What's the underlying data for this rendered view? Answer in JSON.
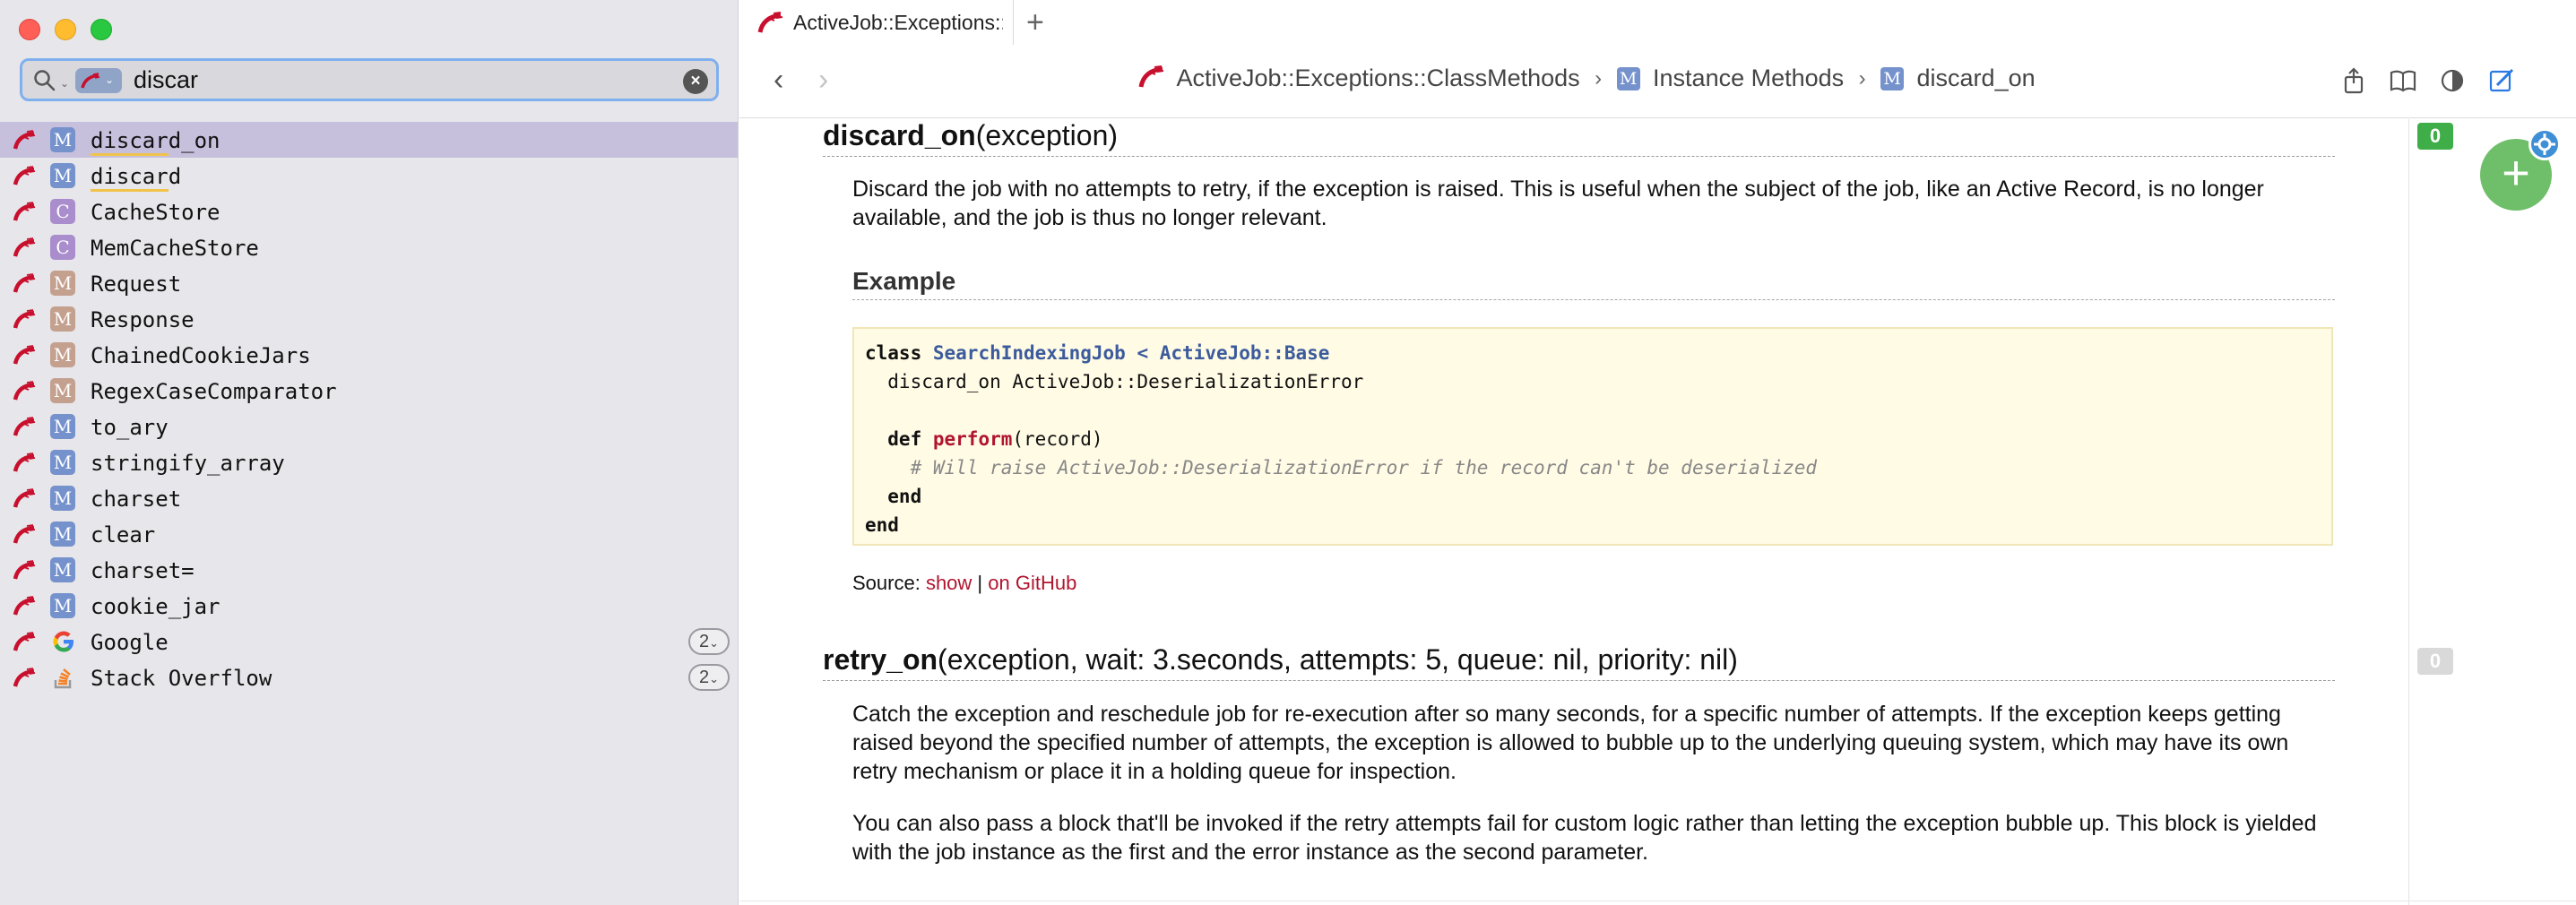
{
  "search": {
    "query": "discar"
  },
  "results": [
    {
      "type": "M",
      "kind": "m",
      "pre": "",
      "hl": "discar",
      "post": "d_on",
      "selected": true
    },
    {
      "type": "M",
      "kind": "m",
      "pre": "",
      "hl": "discar",
      "post": "d"
    },
    {
      "type": "C",
      "kind": "c",
      "name": "CacheStore"
    },
    {
      "type": "C",
      "kind": "c",
      "name": "MemCacheStore"
    },
    {
      "type": "M",
      "kind": "mod",
      "name": "Request"
    },
    {
      "type": "M",
      "kind": "mod",
      "name": "Response"
    },
    {
      "type": "M",
      "kind": "mod",
      "name": "ChainedCookieJars"
    },
    {
      "type": "M",
      "kind": "mod",
      "name": "RegexCaseComparator"
    },
    {
      "type": "M",
      "kind": "m",
      "name": "to_ary"
    },
    {
      "type": "M",
      "kind": "m",
      "name": "stringify_array"
    },
    {
      "type": "M",
      "kind": "m",
      "name": "charset"
    },
    {
      "type": "M",
      "kind": "m",
      "name": "clear"
    },
    {
      "type": "M",
      "kind": "m",
      "name": "charset="
    },
    {
      "type": "M",
      "kind": "m",
      "name": "cookie_jar"
    }
  ],
  "external": [
    {
      "name": "Google",
      "count": "2",
      "icon": "google-icon"
    },
    {
      "name": "Stack Overflow",
      "count": "2",
      "icon": "stack-overflow-icon"
    }
  ],
  "tab": {
    "label": "ActiveJob::Exceptions::ClassMethods",
    "add_label": "+"
  },
  "breadcrumb": {
    "item1": "ActiveJob::Exceptions::ClassMethods",
    "item2": "Instance Methods",
    "item2_badge": "M",
    "item3": "discard_on",
    "item3_badge": "M"
  },
  "doc": {
    "m1_name": "discard_on",
    "m1_args": "(exception)",
    "m1_desc": "Discard the job with no attempts to retry, if the exception is raised. This is useful when the subject of the job, like an Active Record, is no longer available, and the job is thus no longer relevant.",
    "example_title": "Example",
    "code": {
      "l1_kw": "class",
      "l1_cls": "SearchIndexingJob",
      "l1_op": " < ",
      "l1_base": "ActiveJob::Base",
      "l2": "  discard_on ActiveJob::DeserializationError",
      "l4_kw": "  def",
      "l4_fn": "perform",
      "l4_rest": "(record)",
      "l5": "    # Will raise ActiveJob::DeserializationError if the record can't be deserialized",
      "l6": "  end",
      "l7": "end"
    },
    "source_label": "Source: ",
    "source_show": "show",
    "source_sep": " | ",
    "source_github": "on GitHub",
    "m2_name": "retry_on",
    "m2_args": "(exception, wait: 3.seconds, attempts: 5, queue: nil, priority: nil)",
    "m2_desc1": "Catch the exception and reschedule job for re-execution after so many seconds, for a specific number of attempts. If the exception keeps getting raised beyond the specified number of attempts, the exception is allowed to bubble up to the underlying queuing system, which may have its own retry mechanism or place it in a holding queue for inspection.",
    "m2_desc2": "You can also pass a block that'll be invoked if the retry attempts fail for custom logic rather than letting the exception bubble up. This block is yielded with the job instance as the first and the error instance as the second parameter."
  },
  "votes": {
    "v1": "0",
    "v2": "0",
    "v1_color": "#3fae49",
    "v2_color": "#d9d9d9"
  },
  "fab_label": "+"
}
